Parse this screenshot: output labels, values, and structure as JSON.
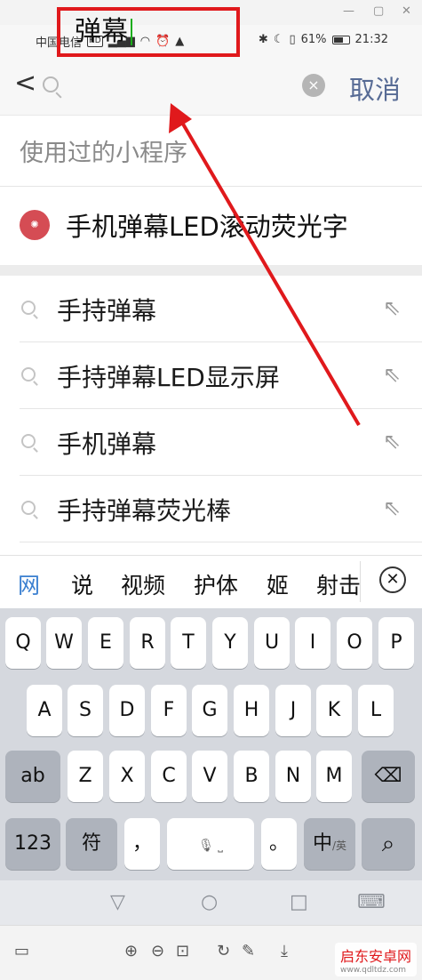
{
  "status": {
    "carrier": "中国电信",
    "network": "HD",
    "battery_pct": "61%",
    "time": "21:32"
  },
  "search": {
    "back": "<",
    "query": "弹幕",
    "clear": "×",
    "cancel": "取消"
  },
  "recent": {
    "title": "使用过的小程序",
    "item_name": "手机弹幕LED滚动荧光字"
  },
  "suggestions": [
    "手持弹幕",
    "手持弹幕LED显示屏",
    "手机弹幕",
    "手持弹幕荧光棒"
  ],
  "candidates": [
    "网",
    "说",
    "视频",
    "护体",
    "姬",
    "射击"
  ],
  "keyboard": {
    "row1": [
      "Q",
      "W",
      "E",
      "R",
      "T",
      "Y",
      "U",
      "I",
      "O",
      "P"
    ],
    "row2": [
      "A",
      "S",
      "D",
      "F",
      "G",
      "H",
      "J",
      "K",
      "L"
    ],
    "row3": [
      "ab",
      "Z",
      "X",
      "C",
      "V",
      "B",
      "N",
      "M"
    ],
    "num_key": "123",
    "symbol_key": "符",
    "comma_key": "，",
    "period_key": "。",
    "lang_key": "中",
    "lang_sub": "/英"
  },
  "watermark": {
    "name": "启东安卓网",
    "url": "www.qdltdz.com"
  },
  "colors": {
    "accent": "#576b95",
    "highlight": "#e0191c"
  }
}
